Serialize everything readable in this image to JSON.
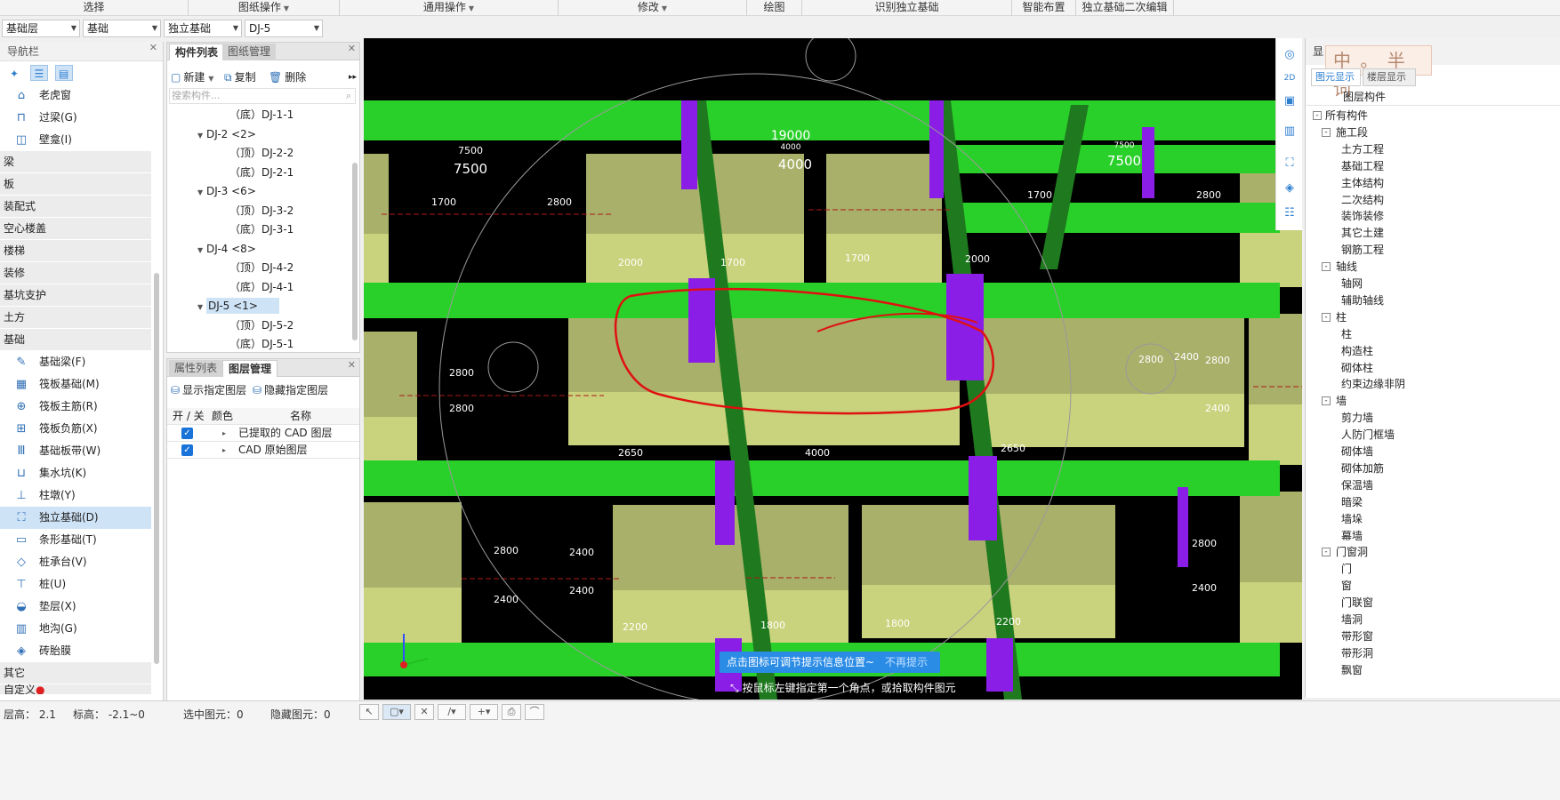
{
  "ribbon": {
    "groups": [
      "选择",
      "图纸操作",
      "通用操作",
      "修改",
      "绘图",
      "识别独立基础",
      "智能布置",
      "独立基础二次编辑"
    ]
  },
  "combos": {
    "floor": "基础层",
    "category": "基础",
    "type": "独立基础",
    "component": "DJ-5"
  },
  "nav": {
    "title": "导航栏",
    "items_top": [
      {
        "label": "老虎窗",
        "icon": "dormer-icon"
      },
      {
        "label": "过梁(G)",
        "icon": "lintel-icon"
      },
      {
        "label": "壁龛(I)",
        "icon": "niche-icon"
      }
    ],
    "categories": [
      "梁",
      "板",
      "装配式",
      "空心楼盖",
      "楼梯",
      "装修",
      "基坑支护",
      "土方",
      "基础"
    ],
    "items_foundation": [
      {
        "label": "基础梁(F)",
        "icon": "foundation-beam-icon"
      },
      {
        "label": "筏板基础(M)",
        "icon": "raft-foundation-icon"
      },
      {
        "label": "筏板主筋(R)",
        "icon": "raft-main-rebar-icon"
      },
      {
        "label": "筏板负筋(X)",
        "icon": "raft-negative-rebar-icon"
      },
      {
        "label": "基础板带(W)",
        "icon": "foundation-strip-icon"
      },
      {
        "label": "集水坑(K)",
        "icon": "sump-pit-icon"
      },
      {
        "label": "柱墩(Y)",
        "icon": "column-pier-icon"
      },
      {
        "label": "独立基础(D)",
        "icon": "isolated-footing-icon"
      },
      {
        "label": "条形基础(T)",
        "icon": "strip-footing-icon"
      },
      {
        "label": "桩承台(V)",
        "icon": "pile-cap-icon"
      },
      {
        "label": "桩(U)",
        "icon": "pile-icon"
      },
      {
        "label": "垫层(X)",
        "icon": "cushion-layer-icon"
      },
      {
        "label": "地沟(G)",
        "icon": "trench-icon"
      },
      {
        "label": "砖胎膜",
        "icon": "brick-mold-icon"
      }
    ],
    "category_bottom": "其它",
    "category_cut": "自定义"
  },
  "complist": {
    "tabs": [
      "构件列表",
      "图纸管理"
    ],
    "new_label": "新建",
    "copy_label": "复制",
    "delete_label": "删除",
    "search_placeholder": "搜索构件...",
    "rows": [
      "（底）DJ-1-1",
      "DJ-2 <2>",
      "（顶）DJ-2-2",
      "（底）DJ-2-1",
      "DJ-3 <6>",
      "（顶）DJ-3-2",
      "（底）DJ-3-1",
      "DJ-4 <8>",
      "（顶）DJ-4-2",
      "（底）DJ-4-1",
      "DJ-5 <1>",
      "（顶）DJ-5-2",
      "（底）DJ-5-1"
    ]
  },
  "layers": {
    "tabs": [
      "属性列表",
      "图层管理"
    ],
    "show_label": "显示指定图层",
    "hide_label": "隐藏指定图层",
    "col_onoff": "开 / 关",
    "col_color": "颜色",
    "col_name": "名称",
    "rows": [
      "已提取的 CAD 图层",
      "CAD 原始图层"
    ]
  },
  "viewport": {
    "dims": [
      "7500",
      "7500",
      "19000",
      "4000",
      "4000",
      "7500",
      "7500",
      "2000",
      "1700",
      "1700",
      "2000",
      "2650",
      "4000",
      "2650",
      "2200",
      "1800",
      "1800",
      "2200",
      "1700",
      "2800",
      "1700",
      "2800",
      "2800",
      "2800",
      "2400",
      "2800",
      "2400",
      "2800",
      "2400",
      "2400",
      "2400",
      "2800",
      "2400",
      "2800"
    ],
    "tip": "点击图标可调节提示信息位置~",
    "tip_dismiss": "不再提示",
    "hint": "按鼠标左键指定第一个角点，或拾取构件图元"
  },
  "rightpanel": {
    "title": "显",
    "ime_text": "中 。 半 词",
    "tabs": [
      "图元显示",
      "楼层显示"
    ],
    "col_header": "图层构件",
    "tree": [
      {
        "label": "所有构件",
        "level": 0,
        "box": "-"
      },
      {
        "label": "施工段",
        "level": 1,
        "box": "-"
      },
      {
        "label": "土方工程",
        "level": 2,
        "box": ""
      },
      {
        "label": "基础工程",
        "level": 2,
        "box": ""
      },
      {
        "label": "主体结构",
        "level": 2,
        "box": ""
      },
      {
        "label": "二次结构",
        "level": 2,
        "box": ""
      },
      {
        "label": "装饰装修",
        "level": 2,
        "box": ""
      },
      {
        "label": "其它土建",
        "level": 2,
        "box": ""
      },
      {
        "label": "钢筋工程",
        "level": 2,
        "box": ""
      },
      {
        "label": "轴线",
        "level": 1,
        "box": "-"
      },
      {
        "label": "轴网",
        "level": 2,
        "box": ""
      },
      {
        "label": "辅助轴线",
        "level": 2,
        "box": ""
      },
      {
        "label": "柱",
        "level": 1,
        "box": "-"
      },
      {
        "label": "柱",
        "level": 2,
        "box": ""
      },
      {
        "label": "构造柱",
        "level": 2,
        "box": ""
      },
      {
        "label": "砌体柱",
        "level": 2,
        "box": ""
      },
      {
        "label": "约束边缘非阴",
        "level": 2,
        "box": ""
      },
      {
        "label": "墙",
        "level": 1,
        "box": "-"
      },
      {
        "label": "剪力墙",
        "level": 2,
        "box": ""
      },
      {
        "label": "人防门框墙",
        "level": 2,
        "box": ""
      },
      {
        "label": "砌体墙",
        "level": 2,
        "box": ""
      },
      {
        "label": "砌体加筋",
        "level": 2,
        "box": ""
      },
      {
        "label": "保温墙",
        "level": 2,
        "box": ""
      },
      {
        "label": "暗梁",
        "level": 2,
        "box": ""
      },
      {
        "label": "墙垛",
        "level": 2,
        "box": ""
      },
      {
        "label": "幕墙",
        "level": 2,
        "box": ""
      },
      {
        "label": "门窗洞",
        "level": 1,
        "box": "-"
      },
      {
        "label": "门",
        "level": 2,
        "box": ""
      },
      {
        "label": "窗",
        "level": 2,
        "box": ""
      },
      {
        "label": "门联窗",
        "level": 2,
        "box": ""
      },
      {
        "label": "墙洞",
        "level": 2,
        "box": ""
      },
      {
        "label": "带形窗",
        "level": 2,
        "box": ""
      },
      {
        "label": "带形洞",
        "level": 2,
        "box": ""
      },
      {
        "label": "飘窗",
        "level": 2,
        "box": ""
      }
    ]
  },
  "status": {
    "floor_height": "层高：  2.1",
    "elevation": "标高：  -2.1~0",
    "selected": "选中图元：0",
    "hidden": "隐藏图元：0"
  },
  "colors": {
    "beam_green": "#2ad02a",
    "column_purple": "#8a1ee6",
    "footing_olive": "#a8b06a",
    "accent_blue": "#2b8ce6",
    "sketch_red": "#e01010"
  }
}
